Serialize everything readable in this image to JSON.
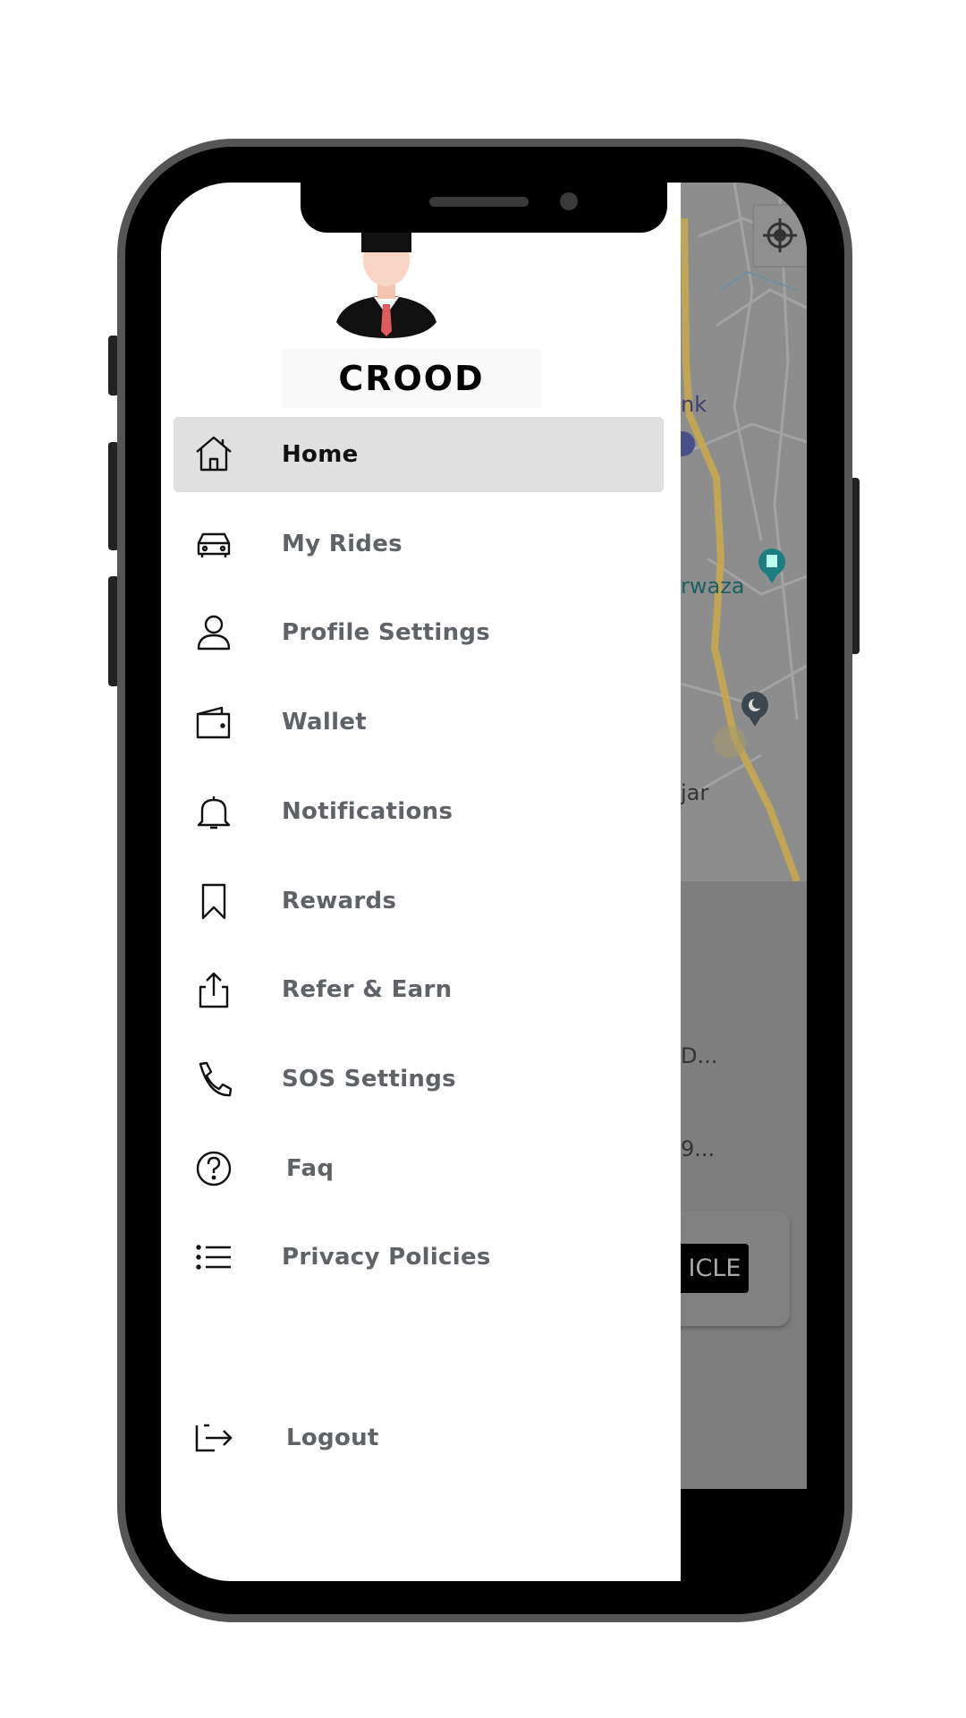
{
  "profile": {
    "name": "CROOD"
  },
  "menu": [
    {
      "label": "Home",
      "icon": "home-icon",
      "active": true
    },
    {
      "label": "My Rides",
      "icon": "car-icon"
    },
    {
      "label": "Profile Settings",
      "icon": "user-icon"
    },
    {
      "label": "Wallet",
      "icon": "wallet-icon"
    },
    {
      "label": "Notifications",
      "icon": "bell-icon"
    },
    {
      "label": "Rewards",
      "icon": "bookmark-icon"
    },
    {
      "label": "Refer & Earn",
      "icon": "share-icon"
    },
    {
      "label": "SOS Settings",
      "icon": "phone-icon"
    },
    {
      "label": "Faq",
      "icon": "help-circle-icon"
    },
    {
      "label": "Privacy Policies",
      "icon": "list-icon"
    }
  ],
  "logout": {
    "label": "Logout",
    "icon": "logout-icon"
  },
  "background": {
    "map_labels": [
      "nk",
      "rwaza",
      "jar"
    ],
    "places": [
      {
        "text": "D..."
      },
      {
        "text": "9..."
      }
    ],
    "button_label": "ICLE"
  },
  "colors": {
    "highlight": "#e0e0e0",
    "label": "#5f6368",
    "route": "#c9a94a",
    "overlay": "#7e7e7e"
  }
}
